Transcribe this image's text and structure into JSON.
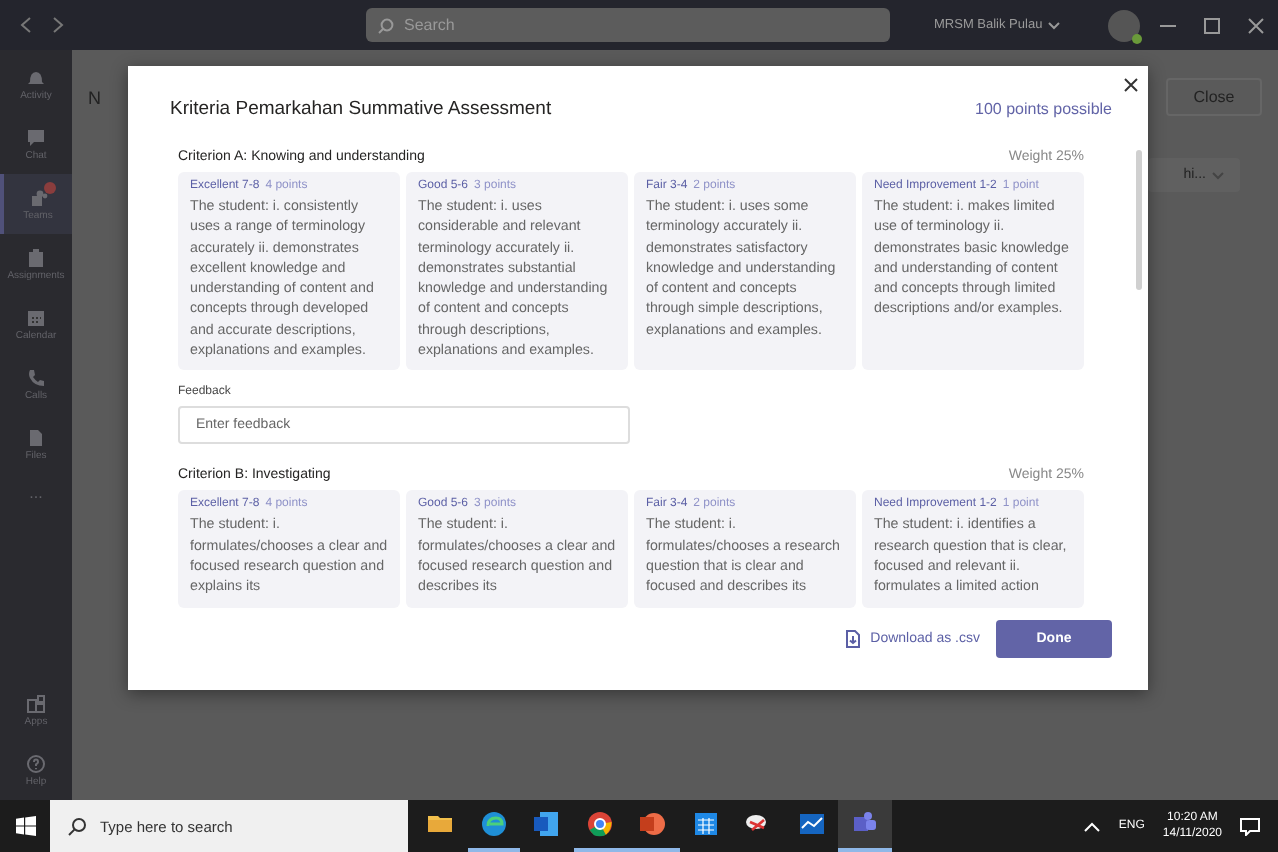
{
  "titlebar": {
    "search_placeholder": "Search",
    "account": "MRSM Balik Pulau"
  },
  "rail": [
    {
      "kind": "activity",
      "label": "Activity",
      "selected": false,
      "badge": false
    },
    {
      "kind": "chat",
      "label": "Chat",
      "selected": false,
      "badge": false
    },
    {
      "kind": "teams",
      "label": "Teams",
      "selected": true,
      "badge": true
    },
    {
      "kind": "assignments",
      "label": "Assignments",
      "selected": false,
      "badge": false
    },
    {
      "kind": "calendar",
      "label": "Calendar",
      "selected": false,
      "badge": false
    },
    {
      "kind": "calls",
      "label": "Calls",
      "selected": false,
      "badge": false
    },
    {
      "kind": "files",
      "label": "Files",
      "selected": false,
      "badge": false
    },
    {
      "kind": "more",
      "label": "...",
      "selected": false,
      "badge": false
    },
    {
      "kind": "apps",
      "label": "Apps",
      "selected": false,
      "badge": false
    },
    {
      "kind": "help",
      "label": "Help",
      "selected": false,
      "badge": false
    }
  ],
  "background": {
    "heading": "N",
    "close_button": "Close",
    "dropdown": "hi..."
  },
  "dialog": {
    "title": "Kriteria Pemarkahan Summative Assessment",
    "points": "100 points possible",
    "criteria": [
      {
        "name": "Criterion A: Knowing and understanding",
        "weight": "Weight 25%",
        "levels": [
          {
            "name": "Excellent 7-8",
            "points": "4 points",
            "description": "The student: i. consistently uses a range of terminology accurately ii. demonstrates excellent knowledge and understanding of content and concepts through developed and accurate descriptions, explanations and examples."
          },
          {
            "name": "Good 5-6",
            "points": "3 points",
            "description": "The student: i. uses considerable and relevant terminology accurately ii. demonstrates substantial knowledge and understanding of content and concepts through descriptions, explanations and examples."
          },
          {
            "name": "Fair 3-4",
            "points": "2 points",
            "description": "The student: i. uses some terminology accurately ii. demonstrates satisfactory knowledge and understanding of content and concepts through simple descriptions, explanations and examples."
          },
          {
            "name": "Need Improvement 1-2",
            "points": "1 point",
            "description": "The student: i. makes limited use of terminology ii. demonstrates basic knowledge and understanding of content and concepts through limited descriptions and/or examples."
          }
        ],
        "feedback": {
          "label": "Feedback",
          "placeholder": "Enter feedback"
        }
      },
      {
        "name": "Criterion B: Investigating",
        "weight": "Weight 25%",
        "levels": [
          {
            "name": "Excellent 7-8",
            "points": "4 points",
            "description": "The student: i. formulates/chooses a clear and focused research question and explains its"
          },
          {
            "name": "Good 5-6",
            "points": "3 points",
            "description": "The student: i. formulates/chooses a clear and focused research question and describes its"
          },
          {
            "name": "Fair 3-4",
            "points": "2 points",
            "description": "The student: i. formulates/chooses a research question that is clear and focused and describes its"
          },
          {
            "name": "Need Improvement 1-2",
            "points": "1 point",
            "description": "The student: i. identifies a research question that is clear, focused and relevant ii. formulates a limited action"
          }
        ]
      }
    ],
    "download": "Download as .csv",
    "done": "Done"
  },
  "taskbar": {
    "search_placeholder": "Type here to search",
    "apps": [
      {
        "kind": "folder",
        "running": false,
        "selected": false
      },
      {
        "kind": "edge",
        "running": true,
        "selected": false
      },
      {
        "kind": "word",
        "running": false,
        "selected": false
      },
      {
        "kind": "chrome",
        "running": true,
        "selected": false
      },
      {
        "kind": "powerpoint",
        "running": true,
        "selected": false
      },
      {
        "kind": "calendar",
        "running": false,
        "selected": false
      },
      {
        "kind": "paint",
        "running": false,
        "selected": false
      },
      {
        "kind": "chart",
        "running": false,
        "selected": false
      },
      {
        "kind": "teams",
        "running": true,
        "selected": true
      }
    ],
    "language": "ENG",
    "time": "10:20 AM",
    "date": "14/11/2020"
  }
}
